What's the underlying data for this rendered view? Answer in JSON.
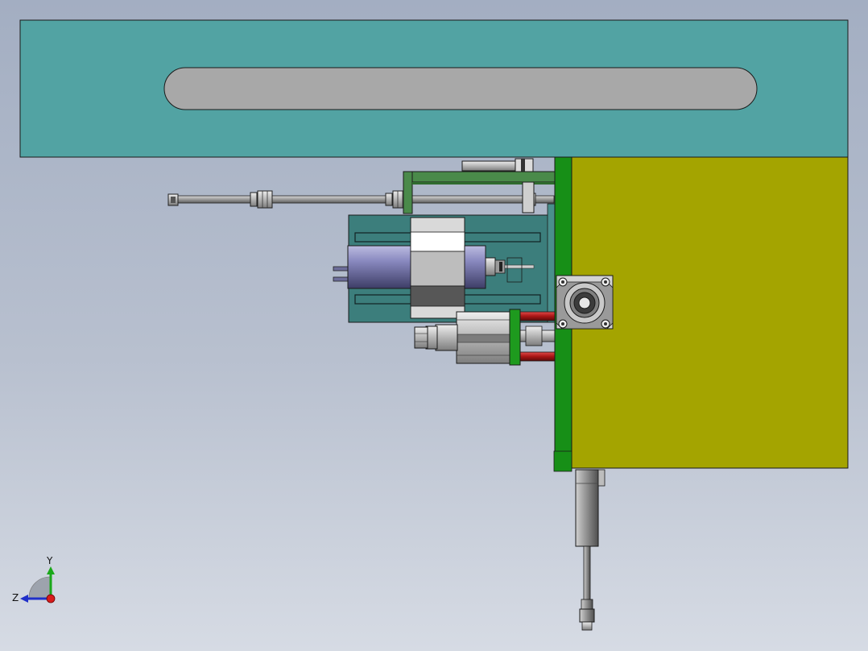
{
  "viewport": {
    "background_top": "#a3aec2",
    "background_bottom": "#d6dbe4"
  },
  "colors": {
    "top_frame": "#52a3a3",
    "slot": "#a8a8a8",
    "main_plate": "#a4a400",
    "side_bar": "#178f17",
    "mount_block": "#3c7e7c",
    "bracket": "#4a8a4a",
    "spindle": "#7373ac",
    "rod_red": "#a81515",
    "outline": "#1a1a1a"
  },
  "triad": {
    "y_label": "Y",
    "z_label": "Z",
    "y_color": "#1aa81a",
    "z_color": "#1f2fc9",
    "x_color": "#d81c1c"
  },
  "parts": [
    {
      "name": "top-frame-plate"
    },
    {
      "name": "frame-slot"
    },
    {
      "name": "main-plate"
    },
    {
      "name": "side-bar"
    },
    {
      "name": "upper-rod"
    },
    {
      "name": "spindle-mount-block"
    },
    {
      "name": "spindle-motor"
    },
    {
      "name": "lower-cylinder"
    },
    {
      "name": "bearing-housing"
    },
    {
      "name": "vertical-cylinder"
    }
  ]
}
